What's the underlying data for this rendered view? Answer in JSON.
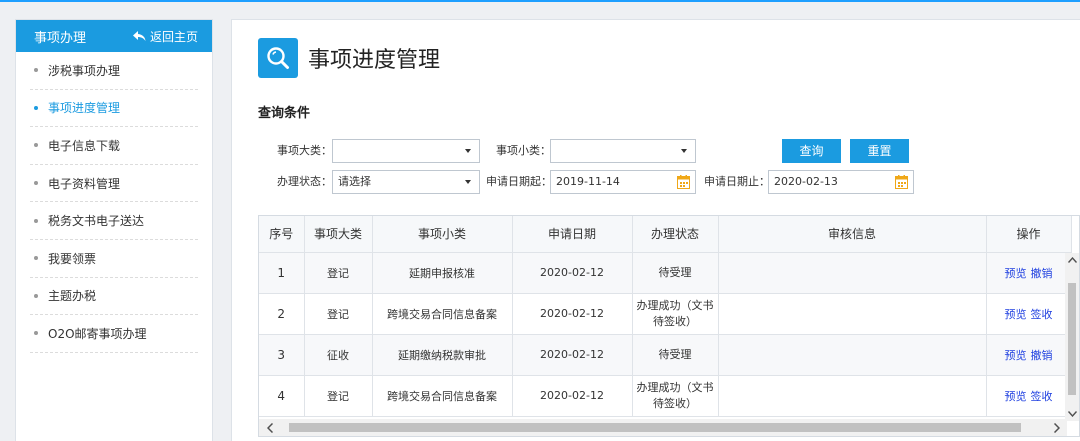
{
  "sidebar": {
    "title": "事项办理",
    "back_label": "返回主页",
    "items": [
      {
        "label": "涉税事项办理",
        "active": false
      },
      {
        "label": "事项进度管理",
        "active": true
      },
      {
        "label": "电子信息下载",
        "active": false
      },
      {
        "label": "电子资料管理",
        "active": false
      },
      {
        "label": "税务文书电子送达",
        "active": false
      },
      {
        "label": "我要领票",
        "active": false
      },
      {
        "label": "主题办税",
        "active": false
      },
      {
        "label": "O2O邮寄事项办理",
        "active": false
      }
    ]
  },
  "main": {
    "page_title": "事项进度管理",
    "section_title": "查询条件",
    "filters": {
      "category_label": "事项大类：",
      "category_value": "",
      "subcategory_label": "事项小类：",
      "subcategory_value": "",
      "status_label": "办理状态：",
      "status_value": "请选择",
      "date_from_label": "申请日期起：",
      "date_from_value": "2019-11-14",
      "date_to_label": "申请日期止：",
      "date_to_value": "2020-02-13"
    },
    "buttons": {
      "search": "查询",
      "reset": "重置"
    },
    "table": {
      "columns": [
        "序号",
        "事项大类",
        "事项小类",
        "申请日期",
        "办理状态",
        "审核信息",
        "操作"
      ],
      "rows": [
        {
          "no": "1",
          "category": "登记",
          "subcategory": "延期申报核准",
          "date": "2020-02-12",
          "status_line1": "待受理",
          "status_line2": "",
          "review": "",
          "op1": "预览",
          "op2": "撤销"
        },
        {
          "no": "2",
          "category": "登记",
          "subcategory": "跨境交易合同信息备案",
          "date": "2020-02-12",
          "status_line1": "办理成功（文书",
          "status_line2": "待签收）",
          "review": "",
          "op1": "预览",
          "op2": "签收"
        },
        {
          "no": "3",
          "category": "征收",
          "subcategory": "延期缴纳税款审批",
          "date": "2020-02-12",
          "status_line1": "待受理",
          "status_line2": "",
          "review": "",
          "op1": "预览",
          "op2": "撤销"
        },
        {
          "no": "4",
          "category": "登记",
          "subcategory": "跨境交易合同信息备案",
          "date": "2020-02-12",
          "status_line1": "办理成功（文书",
          "status_line2": "待签收）",
          "review": "",
          "op1": "预览",
          "op2": "签收"
        }
      ]
    }
  },
  "colors": {
    "accent": "#1b9be0",
    "link": "#1e3fe0",
    "calendar": "#f0a818"
  },
  "icons": {
    "back": "back-arrow-icon",
    "title": "search-icon",
    "date": "calendar-icon"
  }
}
